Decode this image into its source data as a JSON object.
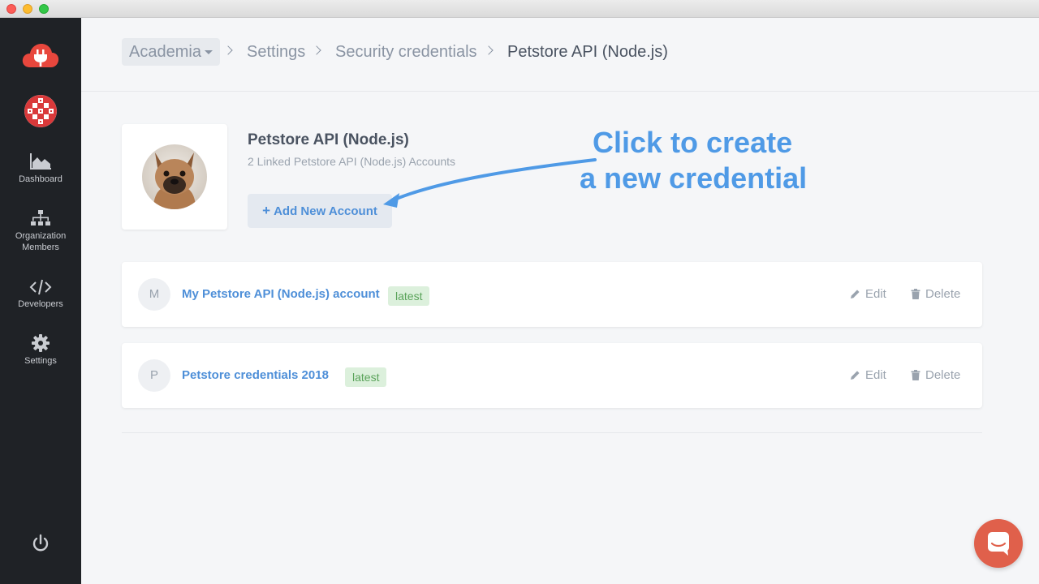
{
  "breadcrumb": {
    "org": "Academia",
    "settings": "Settings",
    "security": "Security credentials",
    "current": "Petstore API (Node.js)"
  },
  "sidebar": {
    "items": [
      {
        "label": "Dashboard",
        "icon": "chart-area-icon"
      },
      {
        "label": "Organization\nMembers",
        "icon": "sitemap-icon"
      },
      {
        "label": "Developers",
        "icon": "code-icon"
      },
      {
        "label": "Settings",
        "icon": "gear-icon"
      }
    ]
  },
  "api": {
    "title": "Petstore API (Node.js)",
    "subtitle": "2 Linked Petstore API (Node.js) Accounts",
    "add_button": "Add New Account"
  },
  "annotation": {
    "line1": "Click to create",
    "line2": "a new credential"
  },
  "credentials": [
    {
      "initial": "M",
      "name": "My Petstore API (Node.js) account",
      "badge": "latest",
      "edit": "Edit",
      "delete": "Delete"
    },
    {
      "initial": "P",
      "name": "Petstore credentials 2018",
      "badge": "latest",
      "edit": "Edit",
      "delete": "Delete"
    }
  ],
  "colors": {
    "accent": "#4e8fd8",
    "annotation": "#4f9ae6",
    "sidebar": "#1f2226",
    "badge_bg": "#dcf0dc",
    "chat": "#e0604b"
  }
}
